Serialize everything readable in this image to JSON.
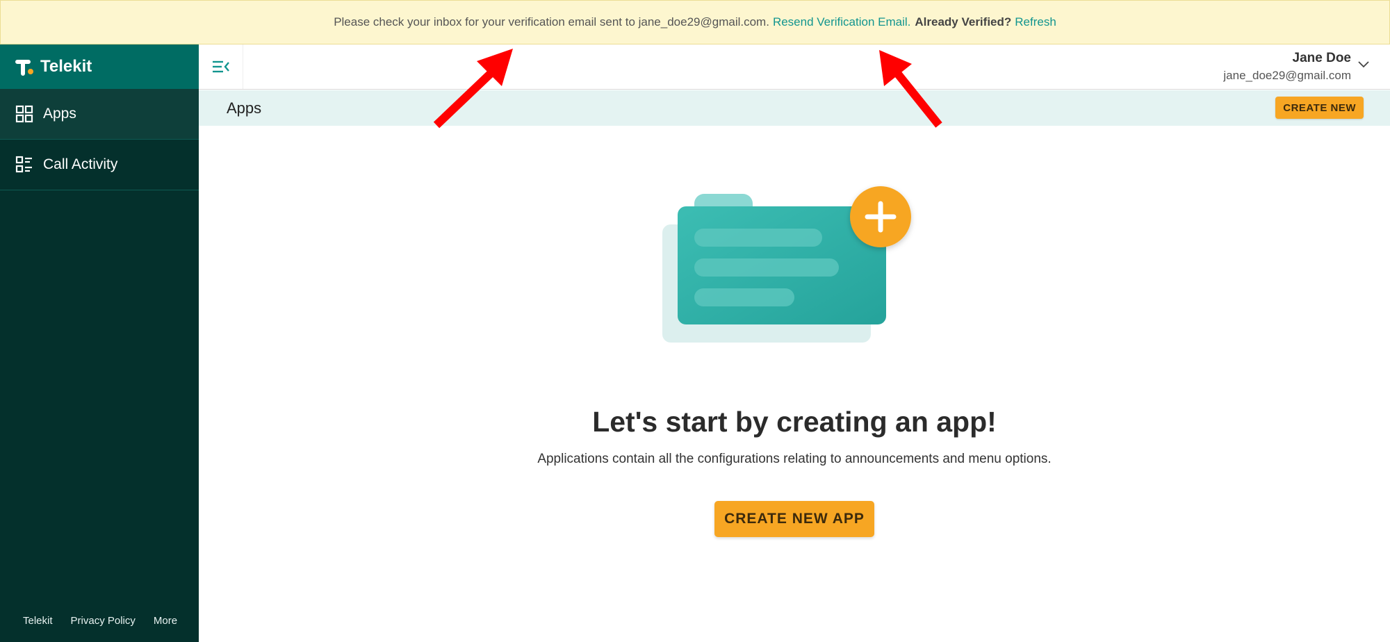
{
  "banner": {
    "message": "Please check your inbox for your verification email sent to jane_doe29@gmail.com.",
    "resend_link": "Resend Verification Email.",
    "already_verified": "Already Verified?",
    "refresh_link": "Refresh"
  },
  "sidebar": {
    "brand": "Telekit",
    "items": [
      {
        "label": "Apps",
        "icon": "grid-icon"
      },
      {
        "label": "Call Activity",
        "icon": "list-icon"
      }
    ],
    "footer": [
      "Telekit",
      "Privacy Policy",
      "More"
    ]
  },
  "topbar": {
    "user_name": "Jane Doe",
    "user_email": "jane_doe29@gmail.com"
  },
  "subheader": {
    "title": "Apps",
    "create_label": "CREATE NEW"
  },
  "empty_state": {
    "headline": "Let's start by creating an app!",
    "description": "Applications contain all the configurations relating to announcements and menu options.",
    "button_label": "CREATE NEW APP"
  },
  "colors": {
    "sidebar": "#04302c",
    "brand": "#006c63",
    "accent": "#f7a623",
    "link": "#12958f",
    "annotation_arrow": "#ff0000"
  }
}
